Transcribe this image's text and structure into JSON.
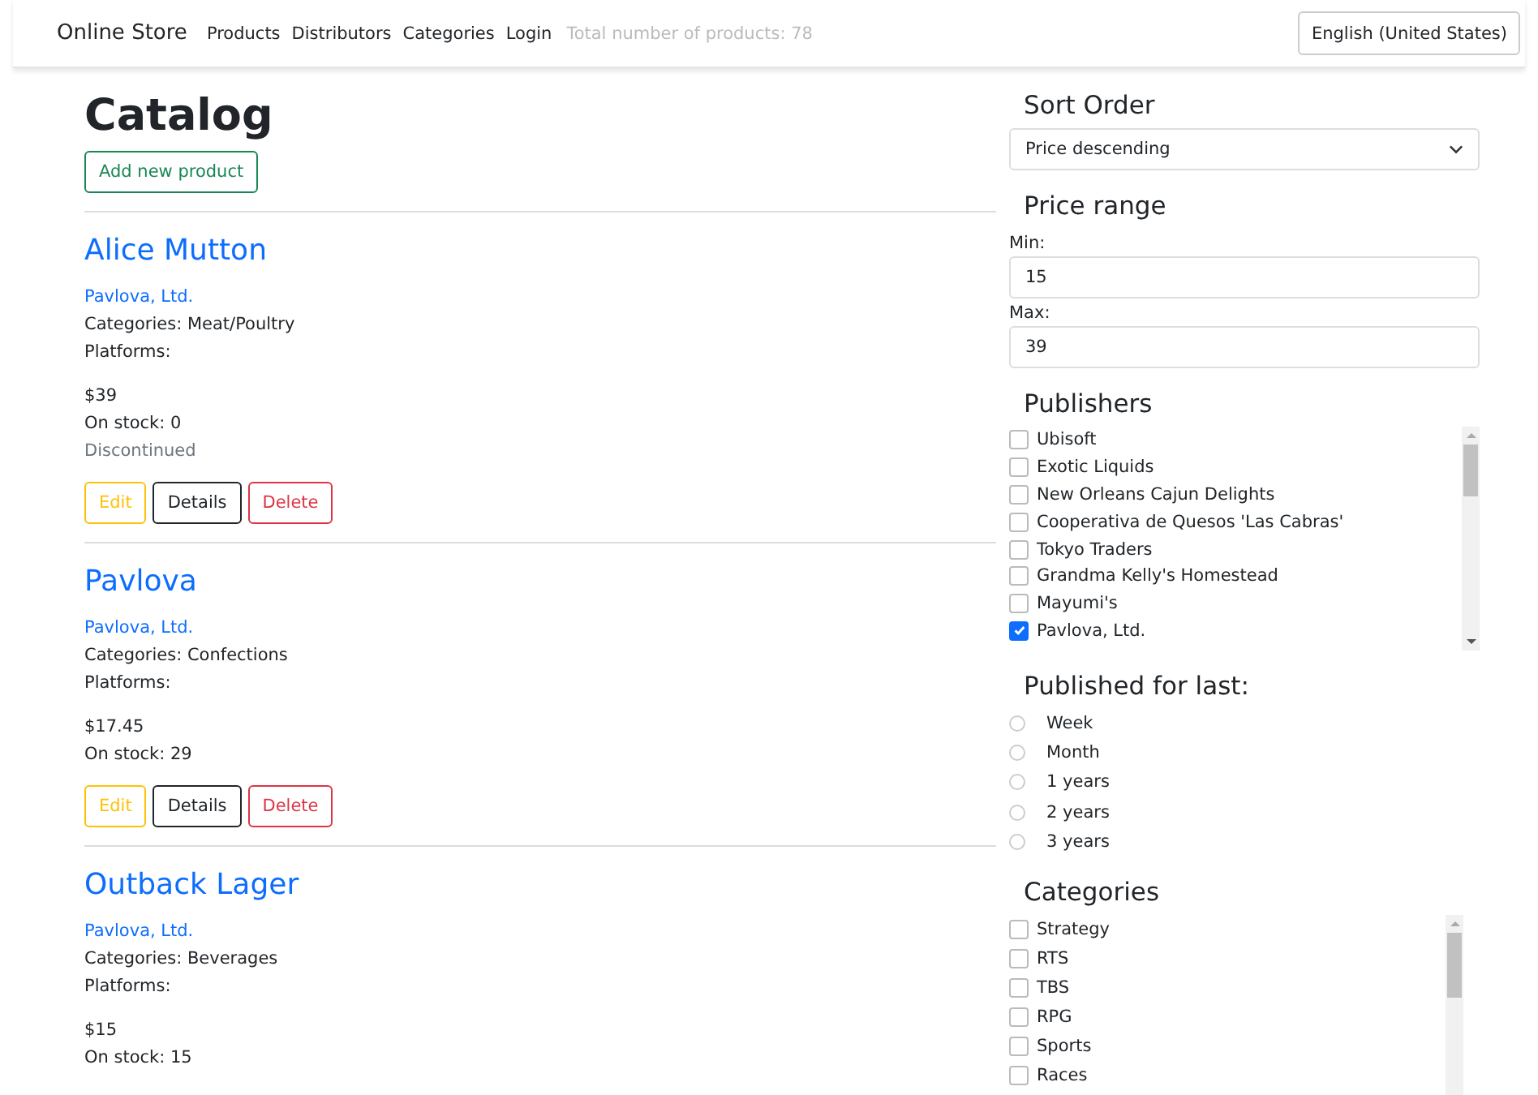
{
  "navbar": {
    "brand": "Online Store",
    "links": [
      "Products",
      "Distributors",
      "Categories",
      "Login"
    ],
    "total": "Total number of products: 78",
    "language": "English (United States)"
  },
  "catalog": {
    "title": "Catalog",
    "add_button": "Add new product",
    "products": [
      {
        "name": "Alice Mutton",
        "publisher": "Pavlova, Ltd.",
        "categories": "Categories: Meat/Poultry",
        "platforms": "Platforms:",
        "price": "$39",
        "stock": "On stock: 0",
        "status": "Discontinued",
        "actions": [
          {
            "kind": "edit",
            "label": "Edit"
          },
          {
            "kind": "details",
            "label": "Details"
          },
          {
            "kind": "delete",
            "label": "Delete"
          }
        ]
      },
      {
        "name": "Pavlova",
        "publisher": "Pavlova, Ltd.",
        "categories": "Categories: Confections",
        "platforms": "Platforms:",
        "price": "$17.45",
        "stock": "On stock: 29",
        "actions": [
          {
            "kind": "edit",
            "label": "Edit"
          },
          {
            "kind": "details",
            "label": "Details"
          },
          {
            "kind": "delete",
            "label": "Delete"
          }
        ]
      },
      {
        "name": "Outback Lager",
        "publisher": "Pavlova, Ltd.",
        "categories": "Categories: Beverages",
        "platforms": "Platforms:",
        "price": "$15",
        "stock": "On stock: 15"
      }
    ]
  },
  "filters": {
    "sort": {
      "title": "Sort Order",
      "value": "Price descending"
    },
    "price": {
      "title": "Price range",
      "min_label": "Min:",
      "min": "15",
      "max_label": "Max:",
      "max": "39"
    },
    "publishers": {
      "title": "Publishers",
      "items": [
        {
          "label": "Ubisoft",
          "checked": false
        },
        {
          "label": "Exotic Liquids",
          "checked": false
        },
        {
          "label": "New Orleans Cajun Delights",
          "checked": false
        },
        {
          "label": "Cooperativa de Quesos 'Las Cabras'",
          "checked": false
        },
        {
          "label": "Tokyo Traders",
          "checked": false
        },
        {
          "label": "Grandma Kelly's Homestead",
          "checked": false
        },
        {
          "label": "Mayumi's",
          "checked": false
        },
        {
          "label": "Pavlova, Ltd.",
          "checked": true
        }
      ]
    },
    "period": {
      "title": "Published for last:",
      "options": [
        {
          "label": "Week",
          "selected": false
        },
        {
          "label": "Month",
          "selected": false
        },
        {
          "label": "1 years",
          "selected": false
        },
        {
          "label": "2 years",
          "selected": false
        },
        {
          "label": "3 years",
          "selected": false
        }
      ]
    },
    "categories": {
      "title": "Categories",
      "items": [
        {
          "label": "Strategy",
          "checked": false
        },
        {
          "label": "RTS",
          "checked": false
        },
        {
          "label": "TBS",
          "checked": false
        },
        {
          "label": "RPG",
          "checked": false
        },
        {
          "label": "Sports",
          "checked": false
        },
        {
          "label": "Races",
          "checked": false
        }
      ]
    }
  }
}
